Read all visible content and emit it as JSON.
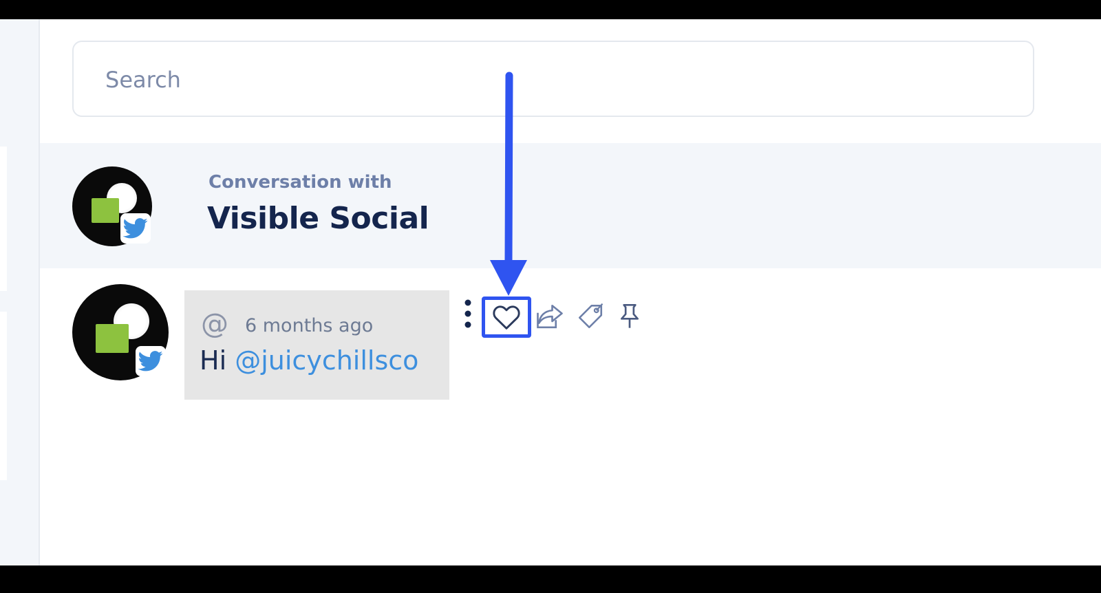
{
  "search": {
    "placeholder": "Search",
    "value": ""
  },
  "conversation": {
    "subtitle": "Conversation with",
    "name": "Visible Social",
    "network_icon": "twitter-icon"
  },
  "message": {
    "type_icon": "at-icon",
    "at_symbol": "@",
    "time": "6 months ago",
    "greeting": "Hi",
    "mention": "@juicychillsco",
    "network_icon": "twitter-icon"
  },
  "actions": [
    {
      "name": "more-options",
      "icon": "vertical-dots-icon"
    },
    {
      "name": "like",
      "icon": "heart-icon",
      "highlighted": true
    },
    {
      "name": "share",
      "icon": "share-icon"
    },
    {
      "name": "tag",
      "icon": "tag-icon"
    },
    {
      "name": "pin",
      "icon": "pin-icon"
    }
  ],
  "colors": {
    "accent_highlight": "#2f54f0",
    "brand_navy": "#14254d",
    "twitter_blue": "#3d8fde",
    "avatar_green": "#8dc23f",
    "header_bg": "#f3f6fa",
    "bubble_bg": "#e6e6e6"
  }
}
